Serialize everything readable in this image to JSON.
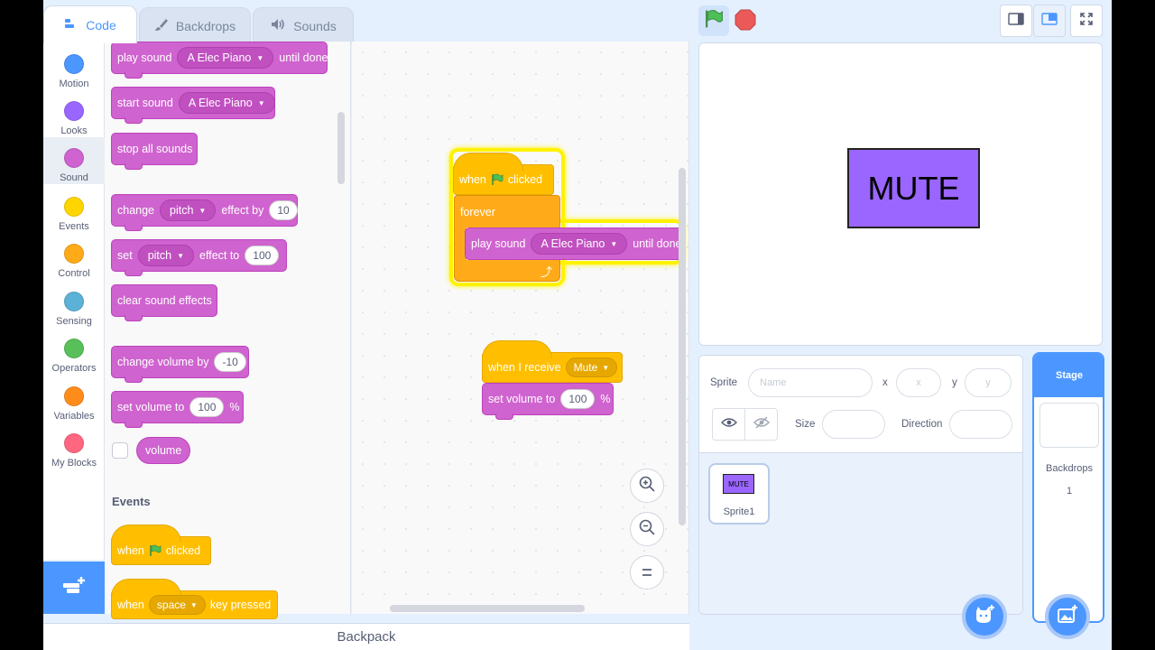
{
  "tabs": [
    {
      "label": "Code",
      "icon": "code-icon"
    },
    {
      "label": "Backdrops",
      "icon": "brush-icon"
    },
    {
      "label": "Sounds",
      "icon": "speaker-icon"
    }
  ],
  "categories": [
    {
      "label": "Motion",
      "color": "#4c97ff"
    },
    {
      "label": "Looks",
      "color": "#9966ff"
    },
    {
      "label": "Sound",
      "color": "#cf63cf"
    },
    {
      "label": "Events",
      "color": "#ffd500"
    },
    {
      "label": "Control",
      "color": "#ffab19"
    },
    {
      "label": "Sensing",
      "color": "#5cb1d6"
    },
    {
      "label": "Operators",
      "color": "#59c059"
    },
    {
      "label": "Variables",
      "color": "#ff8c1a"
    },
    {
      "label": "My Blocks",
      "color": "#ff6680"
    }
  ],
  "palette": {
    "play_sound_until_done": {
      "pre": "play sound",
      "sound": "A Elec Piano",
      "post": "until done"
    },
    "start_sound": {
      "pre": "start sound",
      "sound": "A Elec Piano"
    },
    "stop_all_sounds": "stop all sounds",
    "change_effect": {
      "pre": "change",
      "effect": "pitch",
      "mid": "effect by",
      "value": "10"
    },
    "set_effect": {
      "pre": "set",
      "effect": "pitch",
      "mid": "effect to",
      "value": "100"
    },
    "clear_effects": "clear sound effects",
    "change_volume": {
      "pre": "change volume by",
      "value": "-10"
    },
    "set_volume": {
      "pre": "set volume to",
      "value": "100",
      "unit": "%"
    },
    "volume_reporter": "volume",
    "events_heading": "Events",
    "when_flag": {
      "pre": "when",
      "post": "clicked"
    },
    "when_key": {
      "pre": "when",
      "key": "space",
      "post": "key pressed"
    }
  },
  "script1": {
    "hat": {
      "pre": "when",
      "post": "clicked"
    },
    "forever": "forever",
    "play": {
      "pre": "play sound",
      "sound": "A Elec Piano",
      "post": "until done"
    }
  },
  "script2": {
    "hat": {
      "pre": "when I receive",
      "message": "Mute"
    },
    "set_volume": {
      "pre": "set volume to",
      "value": "100",
      "unit": "%"
    }
  },
  "backpack": "Backpack",
  "stage": {
    "sprite_text": "MUTE"
  },
  "sprite_info": {
    "sprite_label": "Sprite",
    "name_placeholder": "Name",
    "x_label": "x",
    "x_placeholder": "x",
    "y_label": "y",
    "y_placeholder": "y",
    "size_label": "Size",
    "direction_label": "Direction"
  },
  "sprites": [
    {
      "name": "Sprite1",
      "thumb_text": "MUTE"
    }
  ],
  "stage_pane": {
    "title": "Stage",
    "backdrops_label": "Backdrops",
    "backdrops_count": "1"
  }
}
